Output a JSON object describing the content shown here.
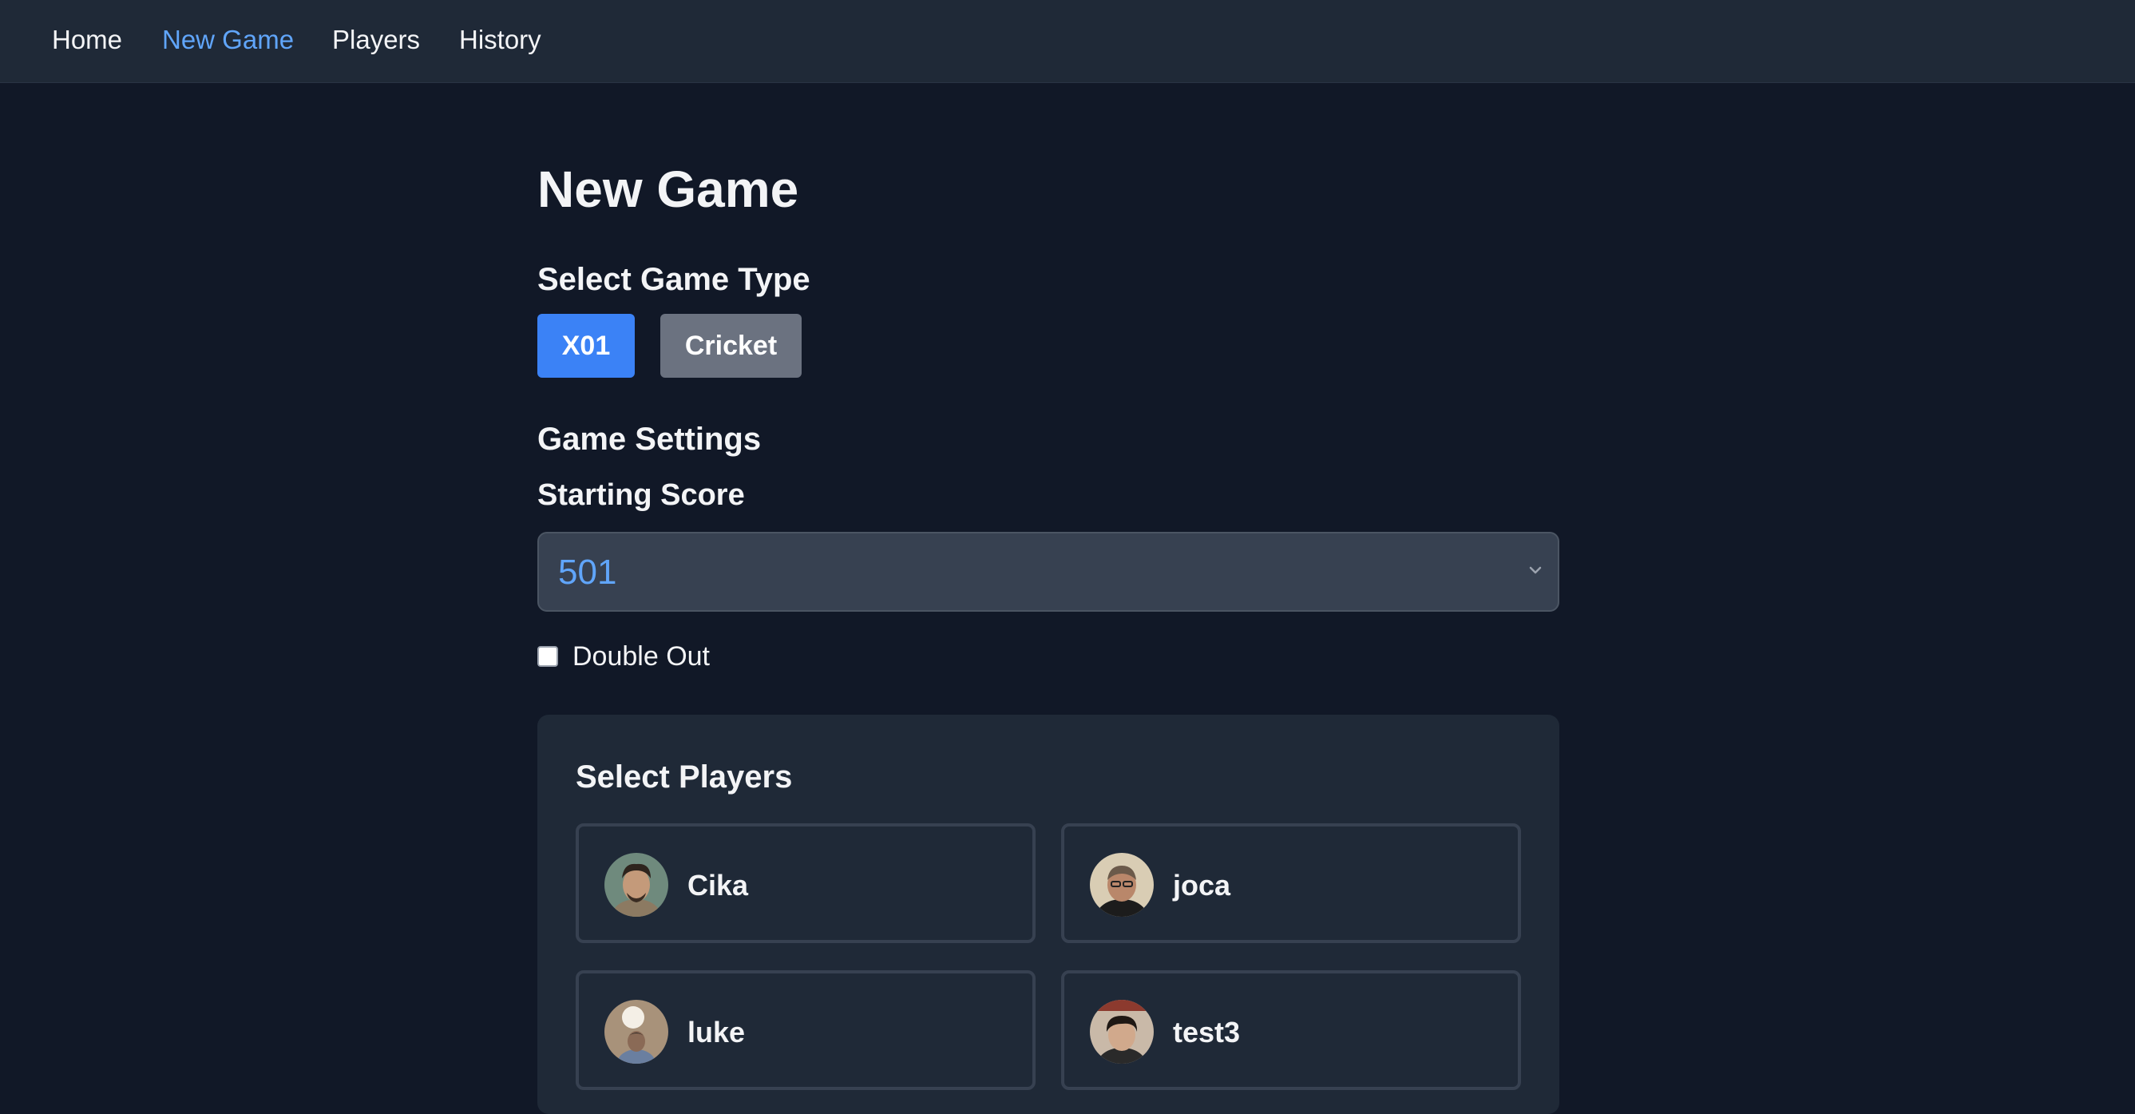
{
  "nav": {
    "items": [
      {
        "label": "Home",
        "active": false
      },
      {
        "label": "New Game",
        "active": true
      },
      {
        "label": "Players",
        "active": false
      },
      {
        "label": "History",
        "active": false
      }
    ],
    "active_color": "#60a5fa"
  },
  "page": {
    "title": "New Game"
  },
  "game_type": {
    "heading": "Select Game Type",
    "options": [
      {
        "label": "X01",
        "selected": true
      },
      {
        "label": "Cricket",
        "selected": false
      }
    ],
    "selected_color": "#3b82f6",
    "unselected_color": "#6b7280"
  },
  "settings": {
    "heading": "Game Settings",
    "starting_score": {
      "label": "Starting Score",
      "value": "501",
      "icon": "chevron-down-icon"
    },
    "double_out": {
      "label": "Double Out",
      "checked": false
    }
  },
  "players": {
    "heading": "Select Players",
    "list": [
      {
        "name": "Cika",
        "avatar": "avatar-photo"
      },
      {
        "name": "joca",
        "avatar": "avatar-photo"
      },
      {
        "name": "luke",
        "avatar": "avatar-photo"
      },
      {
        "name": "test3",
        "avatar": "avatar-photo"
      }
    ]
  },
  "colors": {
    "background": "#111827",
    "surface": "#1f2937",
    "input_bg": "#374151",
    "accent": "#3b82f6",
    "link_active": "#60a5fa"
  }
}
